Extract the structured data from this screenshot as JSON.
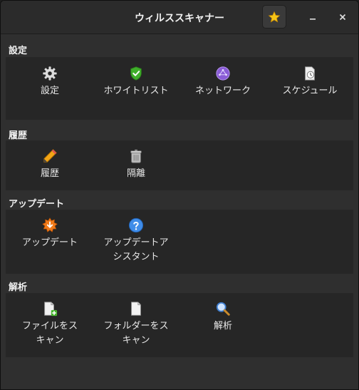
{
  "window": {
    "title": "ウィルススキャナー"
  },
  "titlebar": {
    "favorite_icon": "star-icon",
    "minimize_icon": "minimize-icon",
    "close_icon": "close-icon"
  },
  "sections": [
    {
      "header": "設定",
      "items": [
        {
          "label": "設定",
          "icon": "gear-icon"
        },
        {
          "label": "ホワイトリスト",
          "icon": "shield-check-icon"
        },
        {
          "label": "ネットワーク",
          "icon": "network-icon"
        },
        {
          "label": "スケジュール",
          "icon": "schedule-icon"
        }
      ]
    },
    {
      "header": "履歴",
      "items": [
        {
          "label": "履歴",
          "icon": "pencil-icon"
        },
        {
          "label": "隔離",
          "icon": "quarantine-icon"
        }
      ]
    },
    {
      "header": "アップデート",
      "items": [
        {
          "label": "アップデート",
          "icon": "update-icon"
        },
        {
          "label_line1": "アップデートア",
          "label_line2": "シスタント",
          "icon": "help-icon"
        }
      ]
    },
    {
      "header": "解析",
      "items": [
        {
          "label_line1": "ファイルをス",
          "label_line2": "キャン",
          "icon": "scan-file-icon"
        },
        {
          "label_line1": "フォルダーをス",
          "label_line2": "キャン",
          "icon": "scan-folder-icon"
        },
        {
          "label": "解析",
          "icon": "magnifier-icon"
        }
      ]
    }
  ],
  "colors": {
    "window_bg": "#2f2f2f",
    "panel_bg": "#262626",
    "titlebar_bg": "#2b2b2b",
    "text": "#e8e8e8"
  }
}
